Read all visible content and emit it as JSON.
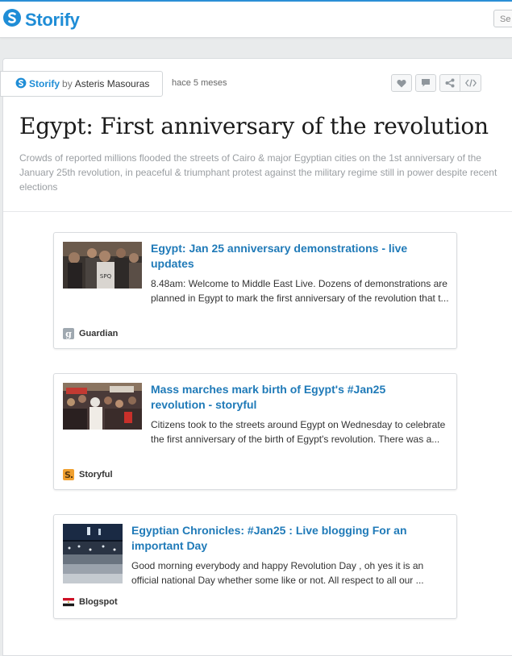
{
  "header": {
    "brand": "Storify",
    "search_text": "Se"
  },
  "byline": {
    "brand": "Storify",
    "by": "by",
    "author": "Asteris Masouras",
    "time_ago": "hace 5 meses"
  },
  "actions": [
    {
      "icon": "heart-icon"
    },
    {
      "icon": "comment-icon"
    },
    {
      "icon": "share-icon"
    },
    {
      "icon": "embed-icon"
    }
  ],
  "story": {
    "title": "Egypt: First anniversary of the revolution",
    "description": "Crowds of reported millions flooded the streets of Cairo & major Egyptian cities on the 1st anniversary of the January 25th revolution, in peaceful & triumphant protest against the military regime still in power despite recent elections"
  },
  "cards": [
    {
      "title": "Egypt: Jan 25 anniversary demonstrations - live updates",
      "text": "8.48am: Welcome to Middle East Live. Dozens of demonstrations are planned in Egypt to mark the first anniversary of the revolution that t...",
      "source": "Guardian",
      "favicon": "guardian-favicon-icon"
    },
    {
      "title": "Mass marches mark birth of Egypt's #Jan25 revolution - storyful",
      "text": "Citizens took to the streets around Egypt on Wednesday to celebrate the first anniversary of the birth of Egypt's revolution. There was a...",
      "source": "Storyful",
      "favicon": "storyful-favicon-icon"
    },
    {
      "title": "Egyptian Chronicles: #Jan25 : Live blogging For an important Day",
      "text": "Good morning everybody and happy Revolution Day , oh yes it is an official national Day whether some like or not. All respect to all our ...",
      "source": "Blogspot",
      "favicon": "egypt-flag-favicon-icon"
    }
  ],
  "colors": {
    "brand_blue": "#1f8dd6",
    "link_blue": "#1f7ab8",
    "muted_text": "#9a9ea2"
  }
}
